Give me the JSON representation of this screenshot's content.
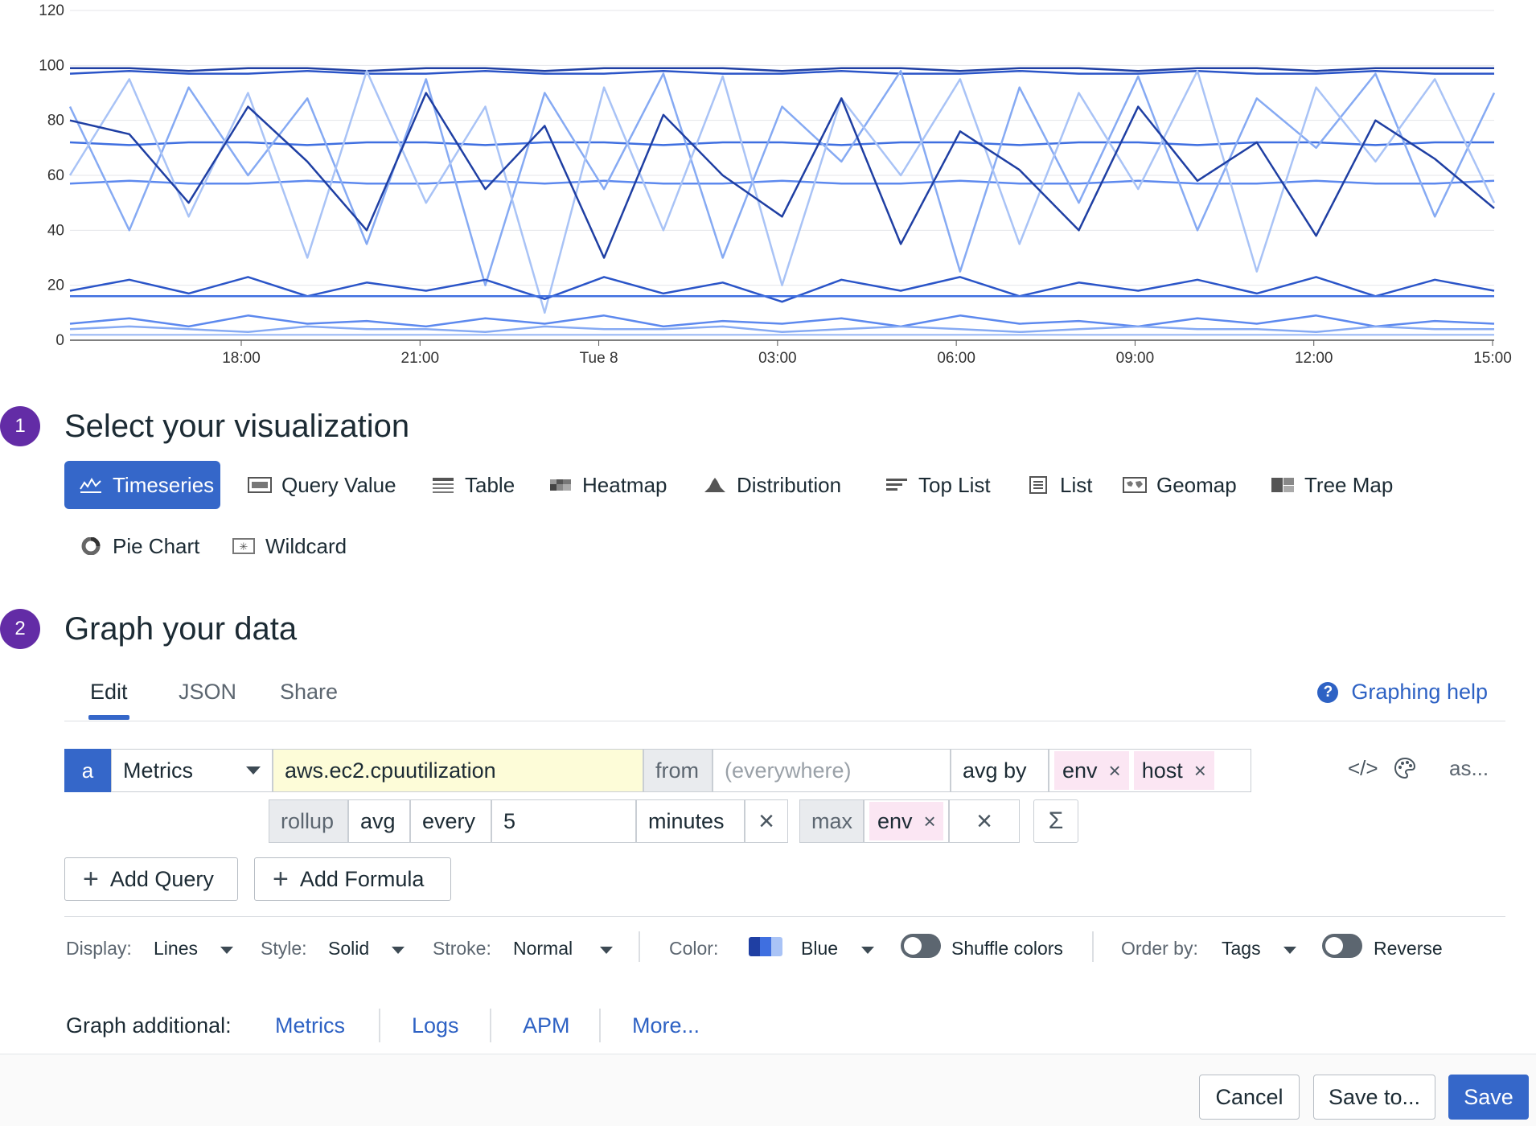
{
  "chart_data": {
    "type": "line",
    "title": "",
    "xlabel": "",
    "ylabel": "",
    "ylim": [
      0,
      120
    ],
    "yticks": [
      0,
      20,
      40,
      60,
      80,
      100,
      120
    ],
    "xticks": [
      "18:00",
      "21:00",
      "Tue 8",
      "03:00",
      "06:00",
      "09:00",
      "12:00",
      "15:00"
    ],
    "grid": true,
    "legend": "none",
    "series_colors": [
      "#1f3fa3",
      "#2b55c8",
      "#3f6fe0",
      "#5d89ee",
      "#86aaf3",
      "#a9c3f6"
    ],
    "series": [
      {
        "values": [
          99,
          99,
          98,
          99,
          99,
          98,
          99,
          99,
          98,
          99,
          99,
          99,
          98,
          99,
          99,
          98,
          99,
          99,
          98,
          99,
          99,
          98,
          99,
          99,
          99
        ]
      },
      {
        "values": [
          97,
          98,
          97,
          97,
          98,
          97,
          97,
          98,
          97,
          97,
          98,
          97,
          97,
          98,
          97,
          97,
          98,
          97,
          97,
          98,
          97,
          97,
          98,
          97,
          97
        ]
      },
      {
        "values": [
          72,
          71,
          72,
          72,
          71,
          72,
          72,
          71,
          72,
          72,
          71,
          72,
          72,
          71,
          72,
          72,
          71,
          72,
          72,
          71,
          72,
          72,
          71,
          72,
          72
        ]
      },
      {
        "values": [
          57,
          58,
          57,
          57,
          58,
          57,
          57,
          58,
          57,
          58,
          57,
          57,
          58,
          57,
          57,
          58,
          57,
          57,
          58,
          57,
          57,
          58,
          57,
          57,
          58
        ]
      },
      {
        "values": [
          85,
          40,
          92,
          60,
          88,
          35,
          95,
          20,
          90,
          55,
          97,
          30,
          85,
          65,
          98,
          25,
          92,
          50,
          96,
          40,
          88,
          70,
          97,
          45,
          90
        ]
      },
      {
        "values": [
          60,
          95,
          45,
          90,
          30,
          98,
          50,
          85,
          10,
          92,
          40,
          96,
          20,
          88,
          60,
          95,
          35,
          90,
          55,
          98,
          25,
          92,
          65,
          95,
          50
        ]
      },
      {
        "values": [
          80,
          75,
          50,
          85,
          65,
          40,
          90,
          55,
          78,
          30,
          82,
          60,
          45,
          88,
          35,
          76,
          62,
          40,
          85,
          58,
          72,
          38,
          80,
          66,
          48
        ]
      },
      {
        "values": [
          18,
          22,
          17,
          23,
          16,
          21,
          18,
          22,
          15,
          23,
          17,
          21,
          14,
          22,
          18,
          23,
          16,
          21,
          18,
          22,
          17,
          23,
          16,
          22,
          18
        ]
      },
      {
        "values": [
          16,
          16,
          16,
          16,
          16,
          16,
          16,
          16,
          16,
          16,
          16,
          16,
          16,
          16,
          16,
          16,
          16,
          16,
          16,
          16,
          16,
          16,
          16,
          16,
          16
        ]
      },
      {
        "values": [
          6,
          8,
          5,
          9,
          6,
          7,
          5,
          8,
          6,
          9,
          5,
          7,
          6,
          8,
          5,
          9,
          6,
          7,
          5,
          8,
          6,
          9,
          5,
          7,
          6
        ]
      },
      {
        "values": [
          4,
          5,
          4,
          3,
          5,
          4,
          4,
          3,
          5,
          4,
          4,
          5,
          3,
          4,
          5,
          4,
          3,
          4,
          5,
          4,
          4,
          3,
          5,
          4,
          4
        ]
      },
      {
        "values": [
          2,
          2,
          2,
          2,
          2,
          2,
          2,
          2,
          2,
          2,
          2,
          2,
          2,
          2,
          2,
          2,
          2,
          2,
          2,
          2,
          2,
          2,
          2,
          2,
          2
        ]
      }
    ]
  },
  "steps": {
    "one": {
      "num": "1",
      "title": "Select your visualization"
    },
    "two": {
      "num": "2",
      "title": "Graph your data"
    }
  },
  "viz": {
    "items": [
      {
        "label": "Timeseries"
      },
      {
        "label": "Query Value"
      },
      {
        "label": "Table"
      },
      {
        "label": "Heatmap"
      },
      {
        "label": "Distribution"
      },
      {
        "label": "Top List"
      },
      {
        "label": "List"
      },
      {
        "label": "Geomap"
      },
      {
        "label": "Tree Map"
      },
      {
        "label": "Pie Chart"
      },
      {
        "label": "Wildcard"
      }
    ],
    "selected": "Timeseries"
  },
  "tabs": [
    {
      "label": "Edit"
    },
    {
      "label": "JSON"
    },
    {
      "label": "Share"
    }
  ],
  "help": {
    "icon": "?",
    "label": "Graphing help"
  },
  "query": {
    "letter": "a",
    "source": "Metrics",
    "metric": "aws.ec2.cpuutilization",
    "from_label": "from",
    "from_placeholder": "(everywhere)",
    "agg_label": "avg by",
    "group_tags": [
      "env",
      "host"
    ],
    "alias_label": "as...",
    "rollup": {
      "label": "rollup",
      "func": "avg",
      "every": "every",
      "value": "5",
      "unit": "minutes"
    },
    "func": {
      "name": "max",
      "tag": "env"
    },
    "sigma": "Σ"
  },
  "buttons": {
    "add_query": "Add Query",
    "add_formula": "Add Formula"
  },
  "display": {
    "display_label": "Display:",
    "display_value": "Lines",
    "style_label": "Style:",
    "style_value": "Solid",
    "stroke_label": "Stroke:",
    "stroke_value": "Normal",
    "color_label": "Color:",
    "color_value": "Blue",
    "color_swatch": [
      "#1f3fa3",
      "#3f6fe0",
      "#a9c3f6"
    ],
    "shuffle_label": "Shuffle colors",
    "order_label": "Order by:",
    "order_value": "Tags",
    "reverse_label": "Reverse"
  },
  "additional": {
    "label": "Graph additional:",
    "links": [
      {
        "label": "Metrics"
      },
      {
        "label": "Logs"
      },
      {
        "label": "APM"
      },
      {
        "label": "More..."
      }
    ]
  },
  "footer": {
    "cancel": "Cancel",
    "save_to": "Save to...",
    "save": "Save"
  }
}
